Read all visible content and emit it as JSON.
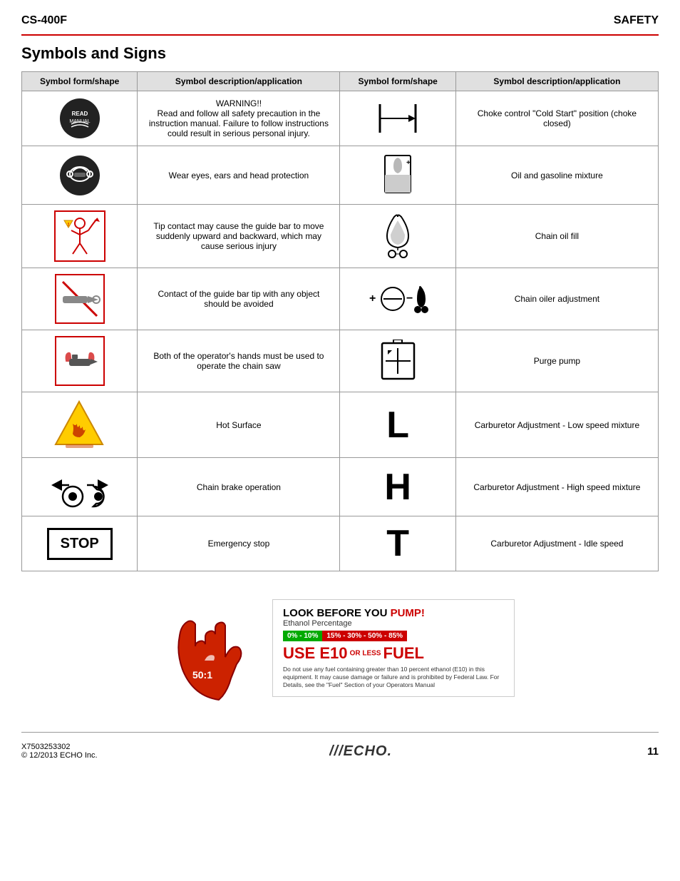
{
  "header": {
    "left": "CS-400F",
    "right": "SAFETY"
  },
  "page_title": "Symbols and Signs",
  "table": {
    "col_headers": [
      "Symbol form/shape",
      "Symbol description/application",
      "Symbol form/shape",
      "Symbol description/application"
    ],
    "rows": [
      {
        "sym1_type": "warning_circle",
        "desc1": "WARNING!!\nRead and follow all safety precaution in the instruction manual. Failure to follow instructions could result in serious personal injury.",
        "sym2_type": "choke",
        "desc2": "Choke control \"Cold Start\" position (choke closed)"
      },
      {
        "sym1_type": "protection",
        "desc1": "Wear eyes, ears and head protection",
        "sym2_type": "oil_mix",
        "desc2": "Oil and gasoline mixture"
      },
      {
        "sym1_type": "tip_contact",
        "desc1": "Tip contact may cause the guide bar to move suddenly upward and backward, which may cause serious injury",
        "sym2_type": "chain_oil_fill",
        "desc2": "Chain oil fill"
      },
      {
        "sym1_type": "guide_bar",
        "desc1": "Contact of the guide bar tip with any object should be avoided",
        "sym2_type": "chain_oiler",
        "desc2": "Chain oiler adjustment"
      },
      {
        "sym1_type": "both_hands",
        "desc1": "Both of the operator's hands must be used to operate the chain saw",
        "sym2_type": "purge_pump",
        "desc2": "Purge pump"
      },
      {
        "sym1_type": "hot_surface",
        "desc1": "Hot Surface",
        "sym2_type": "letter_L",
        "desc2": "Carburetor Adjustment - Low speed mixture"
      },
      {
        "sym1_type": "chain_brake",
        "desc1": "Chain brake operation",
        "sym2_type": "letter_H",
        "desc2": "Carburetor Adjustment - High speed mixture"
      },
      {
        "sym1_type": "stop",
        "desc1": "Emergency stop",
        "sym2_type": "letter_T",
        "desc2": "Carburetor Adjustment - Idle speed"
      }
    ]
  },
  "fuel_warning": {
    "title_black": "LOOK BEFORE YOU ",
    "title_red": "PUMP!",
    "ethanol_label": "Ethanol Percentage",
    "range_green": "0% - 10%",
    "range_red": "15% - 30% - 50% - 85%",
    "use_label": "USE E10",
    "use_suffix": "FUEL",
    "fine_print": "Do not use any fuel containing greater than 10 percent ethanol (E10) in this equipment. It may cause damage or failure and is prohibited by Federal Law. For Details, see the \"Fuel\" Section of your Operators Manual",
    "ratio_label": "50:1"
  },
  "footer": {
    "part_number": "X7503253302",
    "copyright": "© 12/2013 ECHO Inc.",
    "logo": "///ECHO.",
    "page_number": "11"
  }
}
